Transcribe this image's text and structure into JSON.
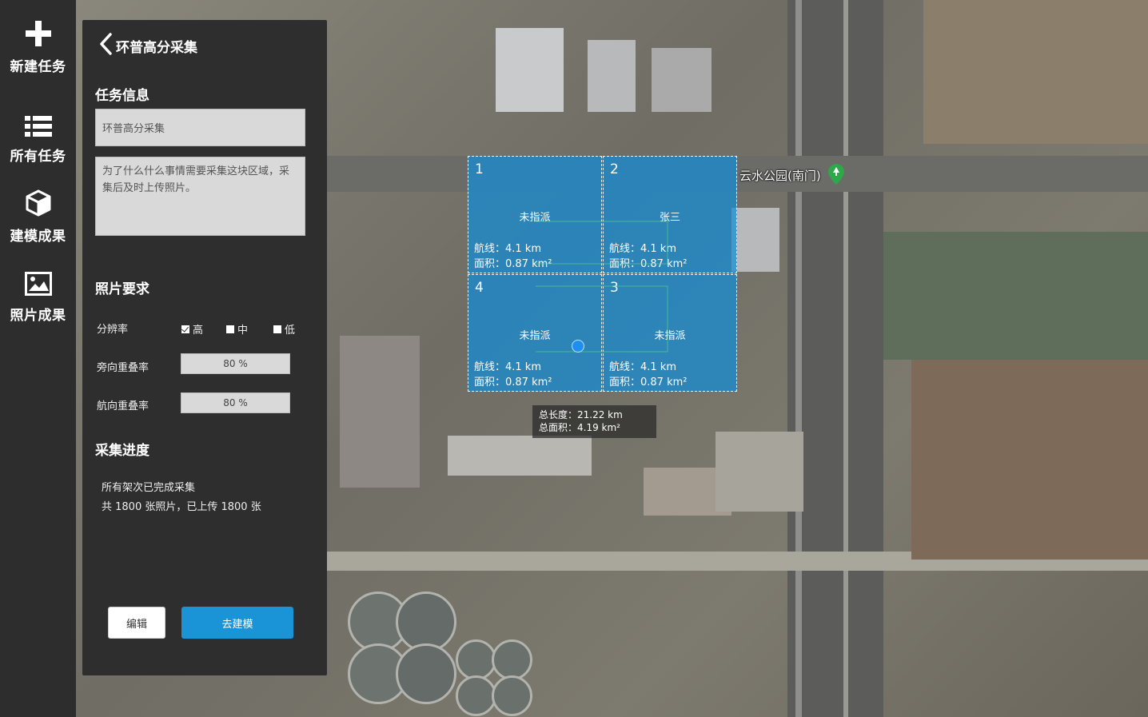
{
  "nav": {
    "items": [
      {
        "label": "新建任务",
        "icon": "plus-icon"
      },
      {
        "label": "所有任务",
        "icon": "list-icon"
      },
      {
        "label": "建模成果",
        "icon": "cube-icon"
      },
      {
        "label": "照片成果",
        "icon": "image-icon"
      }
    ]
  },
  "panel": {
    "header_title": "环普高分采集",
    "task_info": {
      "section_title": "任务信息",
      "name_value": "环普高分采集",
      "description_value": "为了什么什么事情需要采集这块区域，采集后及时上传照片。"
    },
    "photo_req": {
      "section_title": "照片要求",
      "resolution_label": "分辨率",
      "resolution_options": [
        {
          "label": "高",
          "checked": true
        },
        {
          "label": "中",
          "checked": false
        },
        {
          "label": "低",
          "checked": false
        }
      ],
      "side_overlap_label": "旁向重叠率",
      "side_overlap_value": "80 %",
      "forward_overlap_label": "航向重叠率",
      "forward_overlap_value": "80 %"
    },
    "progress": {
      "section_title": "采集进度",
      "line1": "所有架次已完成采集",
      "line2": "共 1800 张照片，已上传 1800 张"
    },
    "buttons": {
      "edit": "编辑",
      "model": "去建模"
    }
  },
  "map": {
    "poi_label": "云水公园(南门)",
    "cells": [
      {
        "number": "1",
        "assignee": "未指派",
        "route": "航线：4.1 km",
        "area": "面积：0.87 km²"
      },
      {
        "number": "2",
        "assignee": "张三",
        "route": "航线：4.1 km",
        "area": "面积：0.87 km²"
      },
      {
        "number": "4",
        "assignee": "未指派",
        "route": "航线：4.1 km",
        "area": "面积：0.87 km²"
      },
      {
        "number": "3",
        "assignee": "未指派",
        "route": "航线：4.1 km",
        "area": "面积：0.87 km²"
      }
    ],
    "summary": {
      "total_length": "总长度：21.22 km",
      "total_area": "总面积：4.19 km²"
    }
  },
  "colors": {
    "accent": "#1a94d6",
    "cell_fill": "#128cd7",
    "panel_bg": "#2e2e2e",
    "nav_bg": "#2d2d2d"
  }
}
